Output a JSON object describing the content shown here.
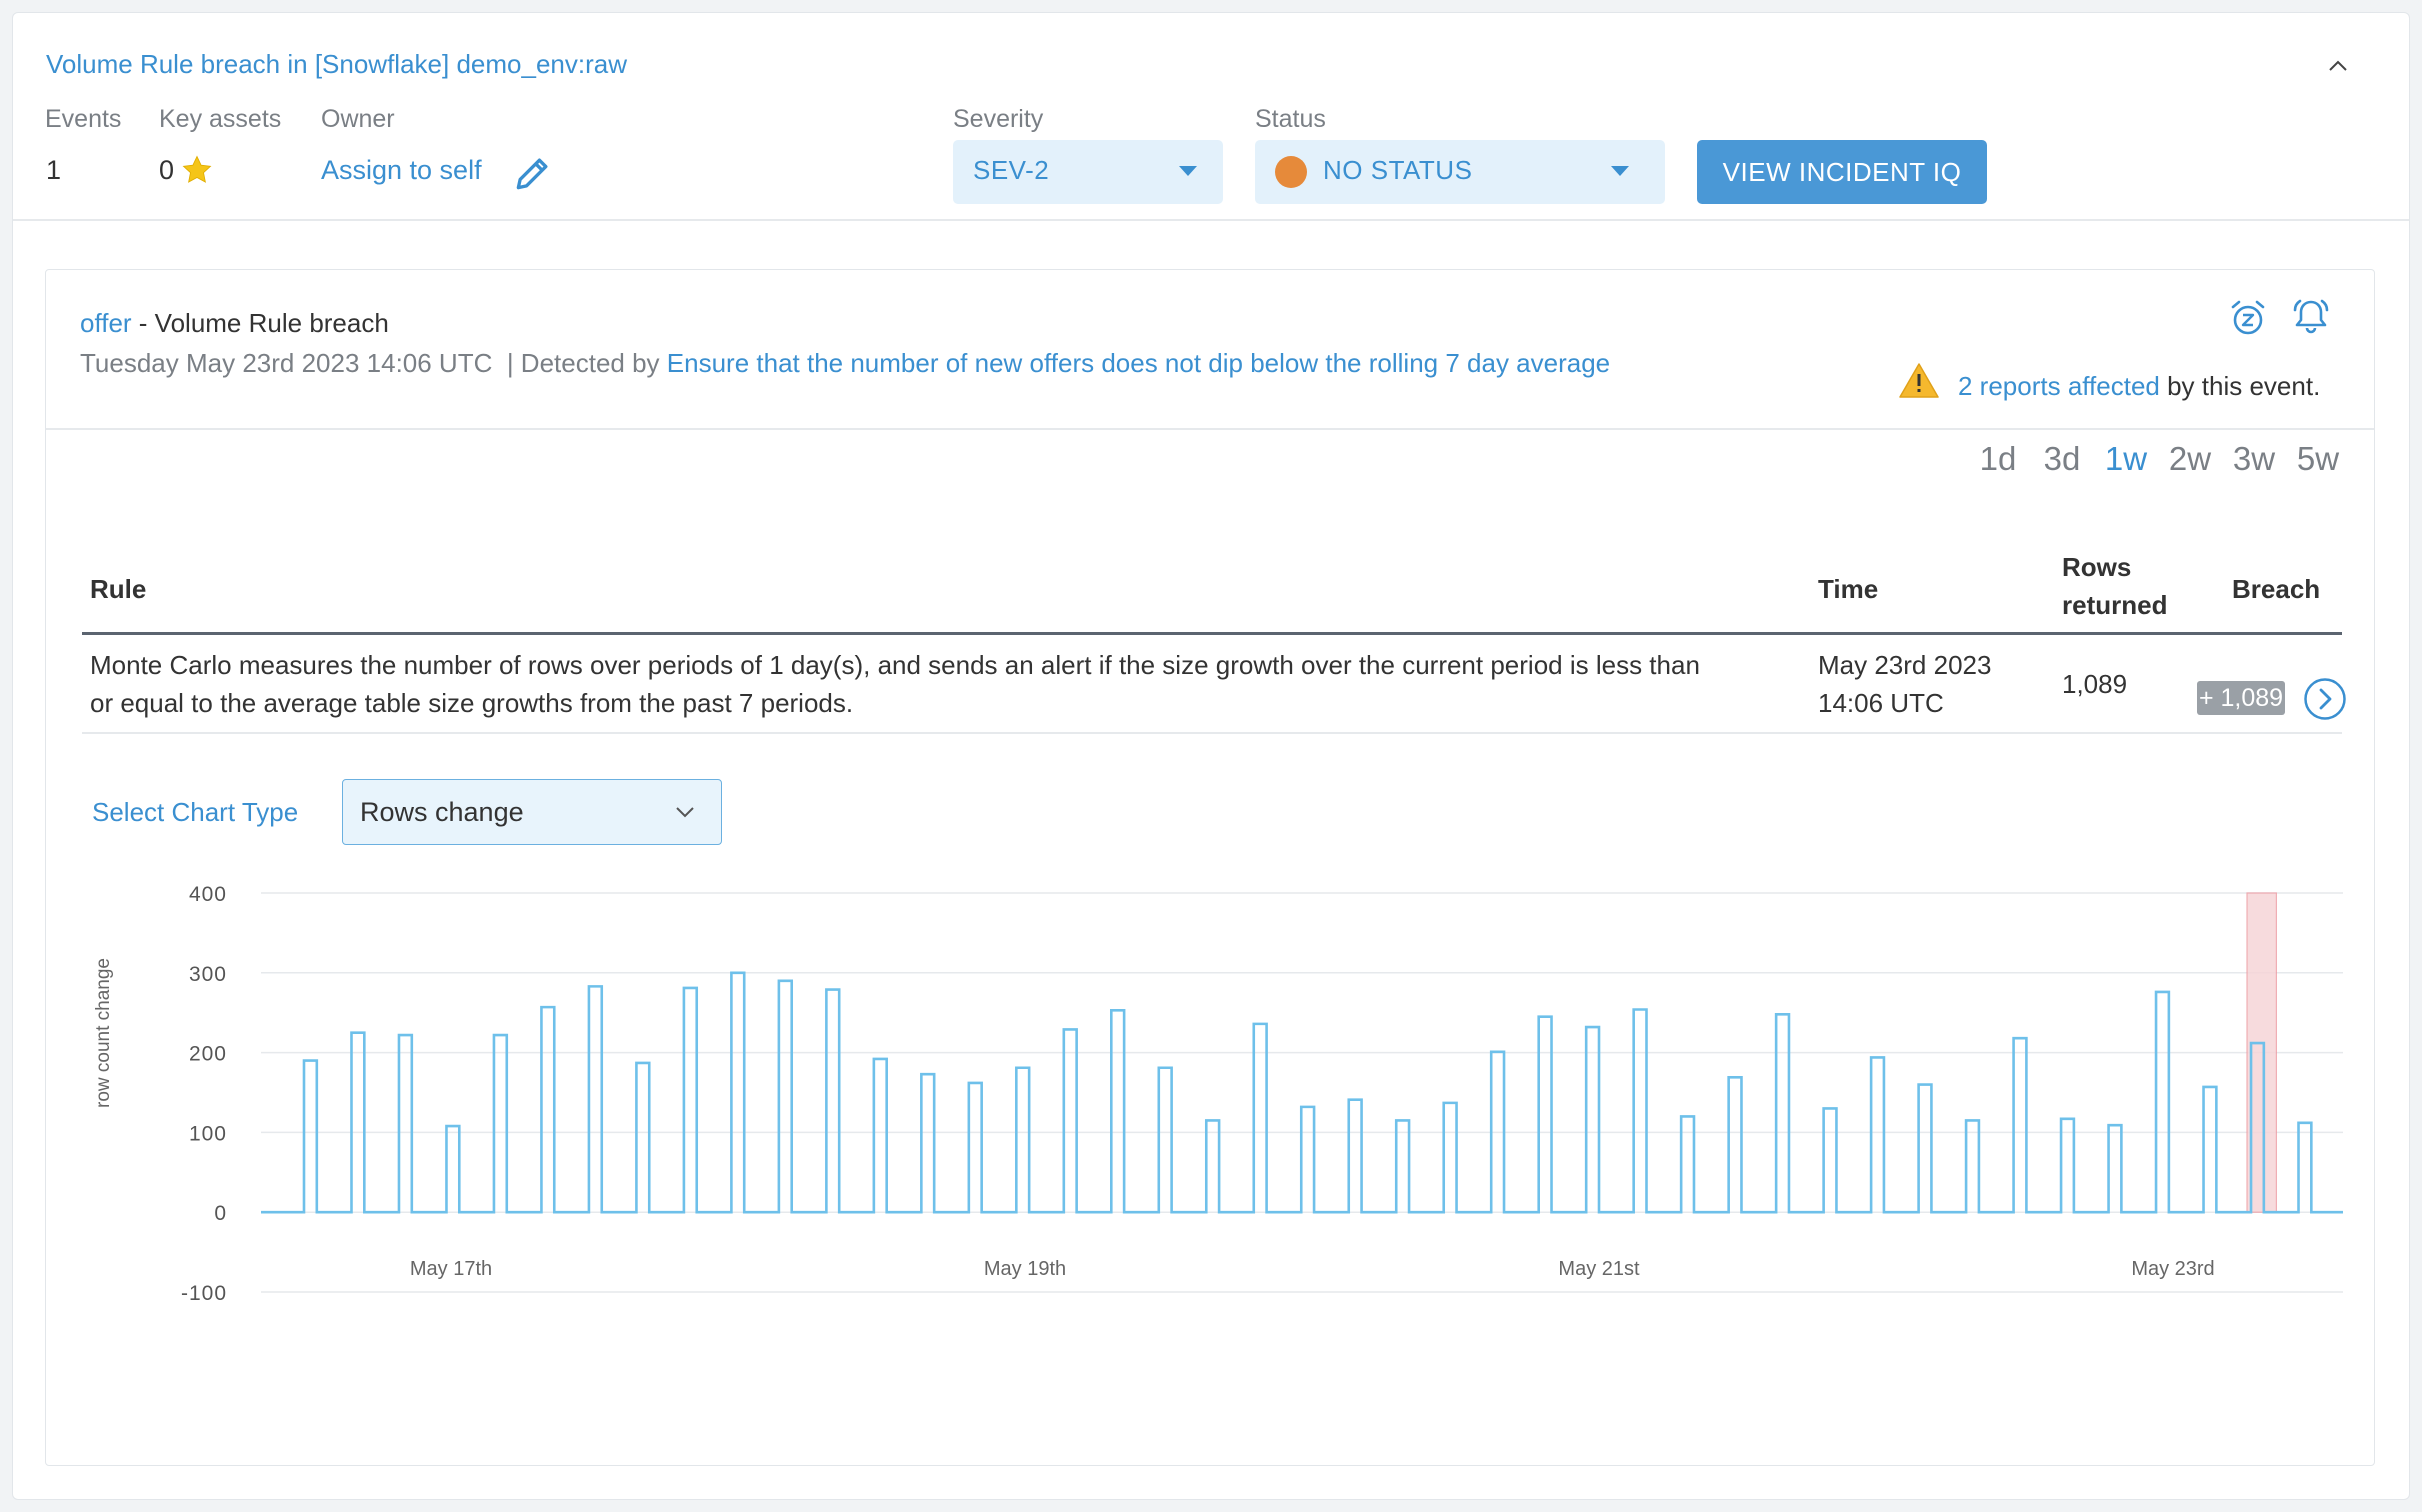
{
  "header": {
    "title": "Volume Rule breach in [Snowflake] demo_env:raw",
    "events_label": "Events",
    "events_value": "1",
    "key_assets_label": "Key assets",
    "key_assets_value": "0",
    "owner_label": "Owner",
    "owner_action": "Assign to self",
    "severity_label": "Severity",
    "severity_value": "SEV-2",
    "status_label": "Status",
    "status_value": "NO STATUS",
    "incident_iq_button": "VIEW INCIDENT IQ"
  },
  "event": {
    "table_name": "offer",
    "separator": " - ",
    "type": "Volume Rule breach",
    "timestamp": "Tuesday May 23rd 2023 14:06 UTC",
    "detected_by_prefix": "  | Detected by ",
    "detected_by_rule": "Ensure that the number of new offers does not dip below the rolling 7 day average",
    "reports_link": "2 reports affected",
    "reports_suffix": " by this event."
  },
  "ranges": [
    "1d",
    "3d",
    "1w",
    "2w",
    "3w",
    "5w"
  ],
  "active_range": "1w",
  "table": {
    "headers": {
      "rule": "Rule",
      "time": "Time",
      "rows_returned_1": "Rows",
      "rows_returned_2": "returned",
      "breach": "Breach"
    },
    "row": {
      "rule_line1": "Monte Carlo measures the number of rows over periods of 1 day(s), and sends an alert if the size growth over the current period is less than",
      "rule_line2": "or equal to the average table size growths from the past 7 periods.",
      "time_line1": "May 23rd 2023",
      "time_line2": "14:06 UTC",
      "rows_returned": "1,089",
      "breach": "+ 1,089"
    }
  },
  "chart_controls": {
    "label": "Select Chart Type",
    "selected": "Rows change"
  },
  "colors": {
    "accent": "#3a8fd0",
    "series": "#6ec0ea",
    "breach_band": "#f6d5d8",
    "status_dot": "#e68a3a"
  },
  "chart_data": {
    "type": "bar",
    "ylabel": "row count change",
    "xlabel": "",
    "ylim": [
      -100,
      400
    ],
    "yticks": [
      400,
      300,
      200,
      100,
      0,
      -100
    ],
    "xticks": [
      "May 17th",
      "May 19th",
      "May 21st",
      "May 23rd"
    ],
    "grid": true,
    "legend": "none",
    "series": [
      {
        "values": [
          190,
          225,
          222,
          108,
          222,
          257,
          283,
          187,
          281,
          300,
          290,
          279,
          192,
          173,
          162,
          181,
          229,
          253,
          181,
          115,
          236,
          132,
          141,
          115,
          137,
          201,
          245,
          232,
          254,
          120,
          169,
          248,
          130,
          194,
          160,
          115,
          218,
          117,
          109,
          276,
          157,
          212,
          112
        ]
      }
    ],
    "breach_index": 41
  }
}
